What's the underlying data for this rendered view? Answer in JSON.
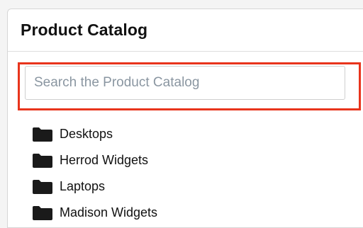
{
  "panel": {
    "title": "Product Catalog"
  },
  "search": {
    "placeholder": "Search the Product Catalog",
    "value": ""
  },
  "catalog": {
    "folder_icon": "folder-icon",
    "items": [
      {
        "label": "Desktops"
      },
      {
        "label": "Herrod Widgets"
      },
      {
        "label": "Laptops"
      },
      {
        "label": "Madison Widgets"
      }
    ]
  },
  "colors": {
    "highlight": "#e8341c",
    "folder": "#1a1a1a"
  }
}
